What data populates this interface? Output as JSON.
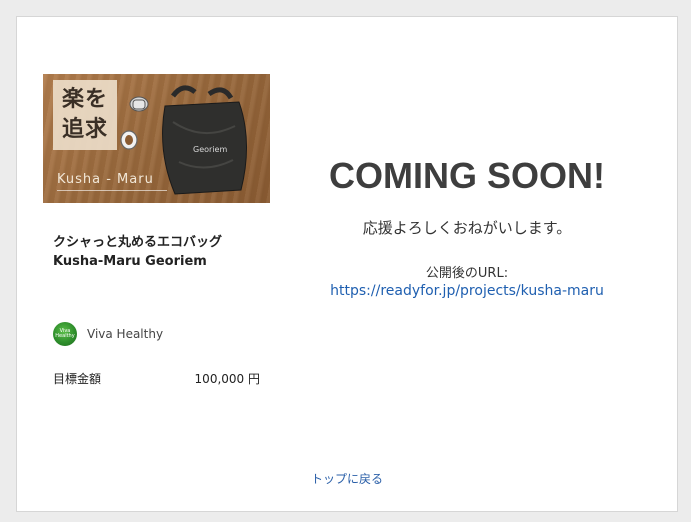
{
  "project": {
    "image": {
      "headline": "楽を\n追求",
      "brand": "Kusha - Maru",
      "bag_print": "Georiem"
    },
    "title_line1": "クシャっと丸めるエコバッグ",
    "title_line2": "Kusha-Maru Georiem",
    "owner": {
      "name": "Viva Healthy",
      "avatar_text": "Viva Healthy"
    },
    "goal": {
      "label": "目標金額",
      "value": "100,000 円"
    }
  },
  "status": {
    "heading": "COMING SOON!",
    "message": "応援よろしくおねがいします。",
    "url_label": "公開後のURL:",
    "url": "https://readyfor.jp/projects/kusha-maru"
  },
  "footer": {
    "back_link": "トップに戻る"
  },
  "colors": {
    "heading": "#3e3e3e",
    "link": "#1f5fb0",
    "avatar": "#2f8f2c"
  }
}
